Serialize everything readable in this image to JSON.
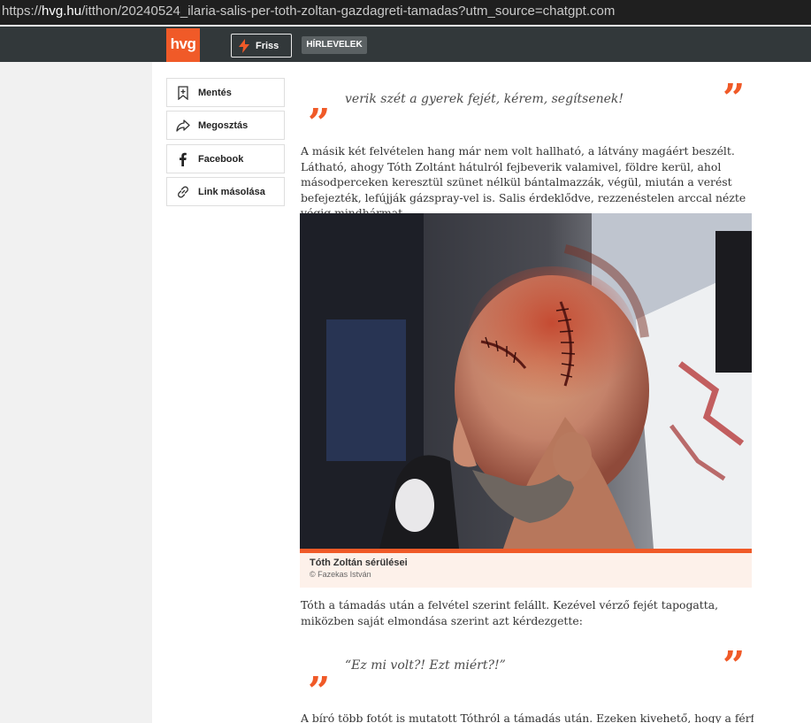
{
  "browser": {
    "url_prefix": "https://",
    "url_domain": "hvg.hu",
    "url_rest": "/itthon/20240524_ilaria-salis-per-toth-zoltan-gazdagreti-tamadas?utm_source=chatgpt.com"
  },
  "nav": {
    "logo": "hvg",
    "friss_label": "Friss",
    "hirlevelek_label": "HÍRLEVELEK"
  },
  "share": [
    {
      "label": "Mentés",
      "icon": "bookmark-icon"
    },
    {
      "label": "Megosztás",
      "icon": "share-icon"
    },
    {
      "label": "Facebook",
      "icon": "facebook-icon"
    },
    {
      "label": "Link másolása",
      "icon": "link-icon"
    }
  ],
  "article": {
    "quote1": "verik szét a gyerek fejét, kérem, segítsenek!",
    "para1": "A másik két felvételen hang már nem volt hallható, a látvány magáért beszélt. Látható, ahogy Tóth Zoltánt hátulról fejbeverik valamivel, földre kerül, ahol másodperceken keresztül szünet nélkül bántalmazzák, végül, miután a verést befejezték, lefújják gázspray-vel is. Salis érdeklődve, rezzenéstelen arccal nézte végig mindhármat.",
    "image_caption": "Tóth Zoltán sérülései",
    "image_credit": "©  Fazekas István",
    "para2": "Tóth a támadás után a felvétel szerint felállt. Kezével vérző fejét tapogatta, miközben saját elmondása szerint azt kérdezgette:",
    "quote2": "“Ez mi volt?! Ezt miért?!”",
    "para3": "A bíró több fotót is mutatott Tóthról a támadás után. Ezeken kivehető, hogy a férfi feje"
  },
  "colors": {
    "accent": "#f05a28",
    "nav_bg": "#32383a"
  }
}
